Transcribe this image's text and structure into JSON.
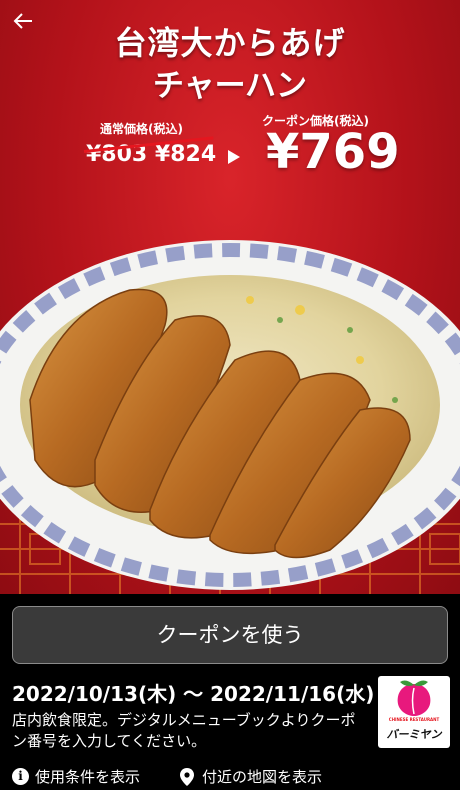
{
  "header": {
    "back_icon": "arrow-left-icon",
    "title_line1": "台湾大からあげ",
    "title_line2": "チャーハン"
  },
  "pricing": {
    "regular_label": "通常価格(税込)",
    "regular_prices": "¥803 ¥824",
    "coupon_label": "クーポン価格(税込)",
    "coupon_price": "¥769",
    "strike_color": "#e5161f"
  },
  "coupon": {
    "use_button_label": "クーポンを使う",
    "validity": "2022/10/13(木) 〜 2022/11/16(水)",
    "note": "店内飲食限定。デジタルメニューブックよりクーポン番号を入力してください。"
  },
  "brand": {
    "tagline": "CHINESE RESTAURANT",
    "name": "バーミヤン",
    "logo_color": "#e8197d"
  },
  "links": {
    "terms_label": "使用条件を表示",
    "terms_icon": "info-icon",
    "map_label": "付近の地図を表示",
    "map_icon": "map-pin-icon"
  }
}
